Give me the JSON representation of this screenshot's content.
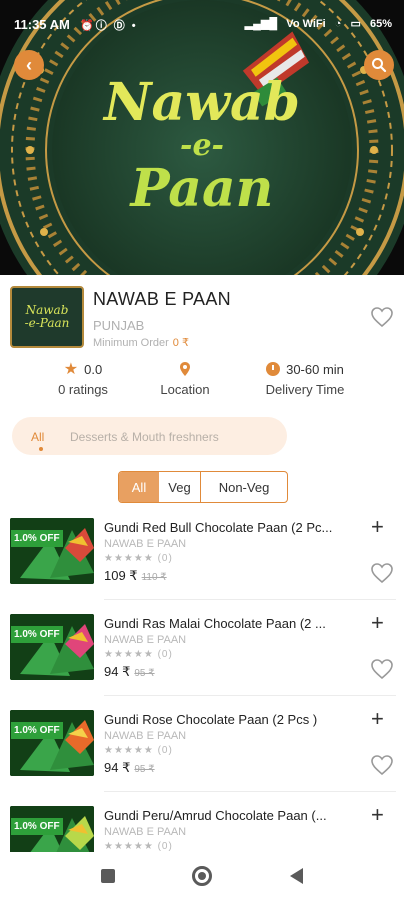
{
  "status_bar": {
    "time": "11:35 AM",
    "battery": "65",
    "network": "Vo WiFi"
  },
  "hero": {
    "logo_line1": "Nawab",
    "logo_line2": "-e-",
    "logo_line3": "Paan"
  },
  "restaurant": {
    "name": "NAWAB E PAAN",
    "city": "PUNJAB",
    "min_order_label": "Minimum Order",
    "min_order_value": "0 ₹",
    "logo_text_1": "Nawab",
    "logo_text_2": "-e-Paan",
    "rating_value": "0.0",
    "rating_label": "0 ratings",
    "location_label": "Location",
    "delivery_value": "30-60 min",
    "delivery_label": "Delivery Time"
  },
  "categories": {
    "all": "All",
    "dessert": "Desserts & Mouth freshners"
  },
  "veg_filter": {
    "all": "All",
    "veg": "Veg",
    "nonveg": "Non-Veg"
  },
  "products": [
    {
      "badge": "1.0% OFF",
      "title": "Gundi Red Bull Chocolate Paan (2 Pc...",
      "brand": "NAWAB E PAAN",
      "stars": "★★★★★ (0)",
      "price": "109 ₹",
      "old_price": "110 ₹"
    },
    {
      "badge": "1.0% OFF",
      "title": "Gundi Ras Malai Chocolate Paan (2 ...",
      "brand": "NAWAB E PAAN",
      "stars": "★★★★★ (0)",
      "price": "94 ₹",
      "old_price": "95 ₹"
    },
    {
      "badge": "1.0% OFF",
      "title": "Gundi Rose Chocolate Paan (2 Pcs )",
      "brand": "NAWAB E PAAN",
      "stars": "★★★★★ (0)",
      "price": "94 ₹",
      "old_price": "95 ₹"
    },
    {
      "badge": "1.0% OFF",
      "title": "Gundi Peru/Amrud Chocolate Paan (...",
      "brand": "NAWAB E PAAN",
      "stars": "★★★★★ (0)"
    }
  ],
  "colors": {
    "accent": "#e08a3a",
    "badge_green": "#2ea03a"
  }
}
